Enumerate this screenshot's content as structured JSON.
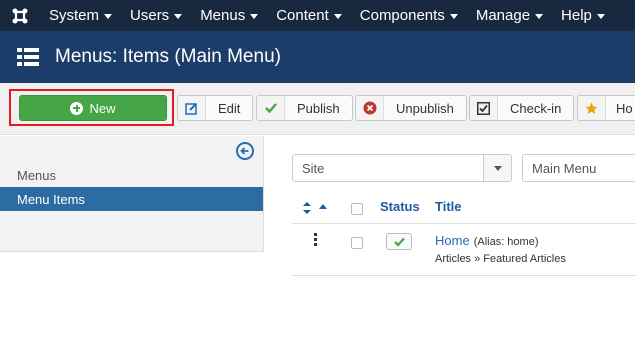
{
  "topnav": {
    "logo": "joomla-icon",
    "items": [
      {
        "label": "System"
      },
      {
        "label": "Users"
      },
      {
        "label": "Menus"
      },
      {
        "label": "Content"
      },
      {
        "label": "Components"
      },
      {
        "label": "Manage"
      },
      {
        "label": "Help"
      }
    ]
  },
  "header": {
    "title": "Menus: Items (Main Menu)",
    "icon": "list-icon"
  },
  "toolbar": {
    "new_label": "New",
    "edit_label": "Edit",
    "publish_label": "Publish",
    "unpublish_label": "Unpublish",
    "checkin_label": "Check-in",
    "home_label": "Ho"
  },
  "sidebar": {
    "items": [
      {
        "label": "Menus",
        "active": false
      },
      {
        "label": "Menu Items",
        "active": true
      }
    ]
  },
  "filters": {
    "site_select": "Site",
    "menu_select": "Main Menu"
  },
  "table": {
    "columns": {
      "status": "Status",
      "title": "Title"
    },
    "rows": [
      {
        "title": "Home",
        "alias": "(Alias: home)",
        "subtitle": "Articles » Featured Articles",
        "published": true
      }
    ]
  },
  "colors": {
    "topnav_bg": "#18293f",
    "header_bg": "#1c3c6a",
    "new_button": "#46a546",
    "highlight": "#e11b23",
    "sidebar_active": "#2d6ca2",
    "link": "#2a69b8"
  }
}
